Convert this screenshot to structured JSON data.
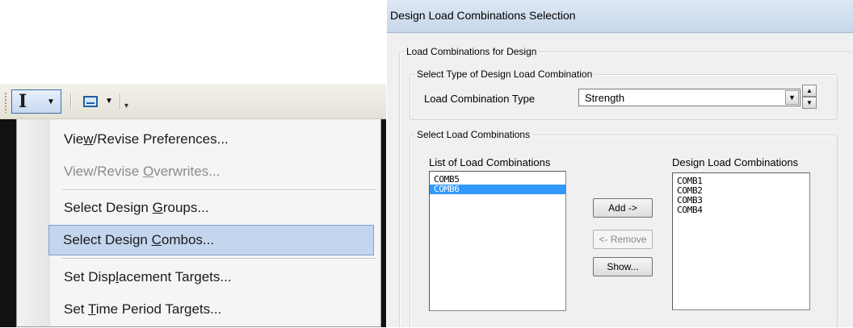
{
  "toolbar": {
    "icons": [
      "text-cursor-icon",
      "chevron-down-icon",
      "monitor-icon",
      "chevron-down-icon",
      "overflow-icon"
    ],
    "arrow_glyph": "▼",
    "overflow_glyph": "▾"
  },
  "menu": {
    "items": [
      {
        "label_pre": "Vie",
        "mnemonic": "w",
        "label_post": "/Revise Preferences...",
        "state": "enabled"
      },
      {
        "label_pre": "View/Revise ",
        "mnemonic": "O",
        "label_post": "verwrites...",
        "state": "disabled"
      },
      {
        "label_pre": "Select Design ",
        "mnemonic": "G",
        "label_post": "roups...",
        "state": "enabled"
      },
      {
        "label_pre": "Select Design ",
        "mnemonic": "C",
        "label_post": "ombos...",
        "state": "highlighted"
      },
      {
        "label_pre": "Set Disp",
        "mnemonic": "l",
        "label_post": "acement Targets...",
        "state": "enabled"
      },
      {
        "label_pre": "Set ",
        "mnemonic": "T",
        "label_post": "ime Period Targets...",
        "state": "enabled"
      }
    ]
  },
  "dialog": {
    "title": "Design Load Combinations Selection",
    "group_outer": "Load Combinations for Design",
    "group_type": "Select Type of Design Load Combination",
    "type_label": "Load Combination Type",
    "type_value": "Strength",
    "group_select": "Select Load Combinations",
    "list_header": "List of Load Combinations",
    "design_header": "Design Load Combinations",
    "available": [
      {
        "name": "COMB5",
        "selected": false
      },
      {
        "name": "COMB6",
        "selected": true
      }
    ],
    "design": [
      "COMB1",
      "COMB2",
      "COMB3",
      "COMB4"
    ],
    "buttons": {
      "add": "Add ->",
      "remove": "<- Remove",
      "show": "Show..."
    },
    "button_states": {
      "add": "enabled",
      "remove": "disabled",
      "show": "enabled"
    }
  },
  "colors": {
    "menu_highlight": "#c4d6ee",
    "list_selection": "#3399ff",
    "titlebar": "#c6d6ea"
  }
}
